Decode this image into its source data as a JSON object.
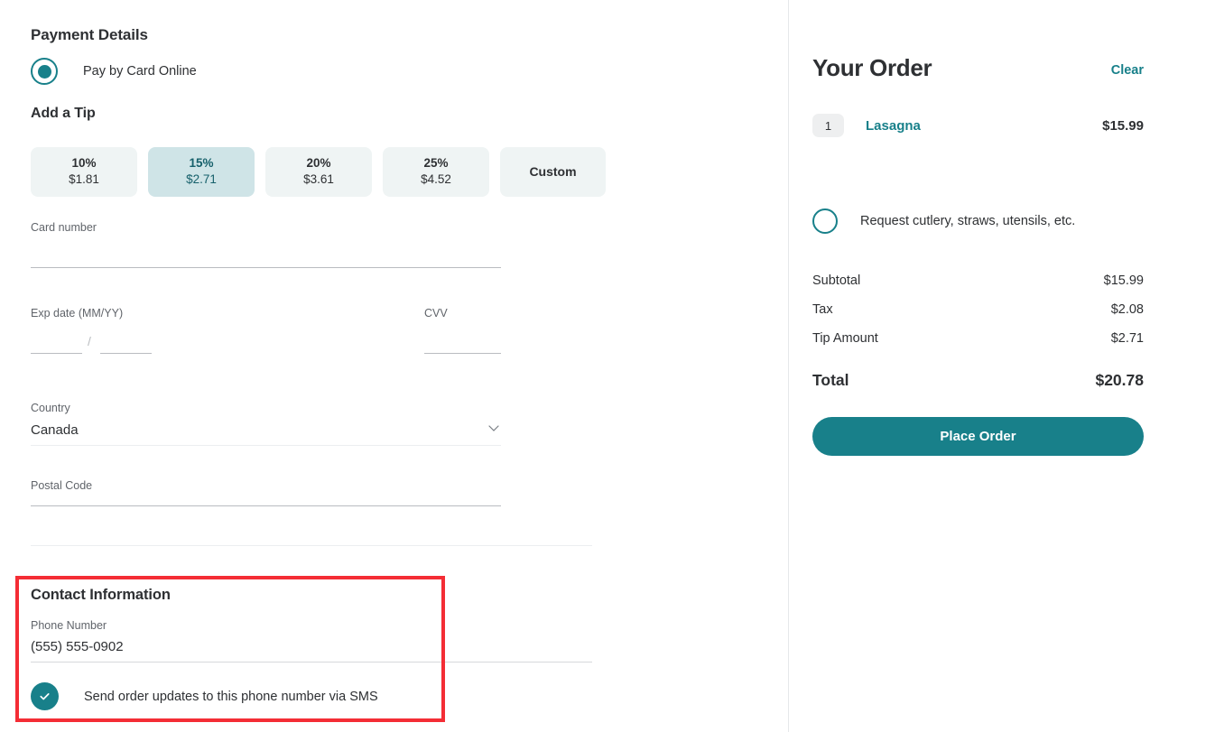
{
  "payment": {
    "section_title": "Payment Details",
    "method_label": "Pay by Card Online",
    "tip_title": "Add a Tip",
    "tips": [
      {
        "percent": "10%",
        "amount": "$1.81",
        "selected": false
      },
      {
        "percent": "15%",
        "amount": "$2.71",
        "selected": true
      },
      {
        "percent": "20%",
        "amount": "$3.61",
        "selected": false
      },
      {
        "percent": "25%",
        "amount": "$4.52",
        "selected": false
      },
      {
        "percent": "Custom",
        "amount": "",
        "selected": false
      }
    ],
    "card_number_label": "Card number",
    "card_number_value": "",
    "exp_label": "Exp date (MM/YY)",
    "exp_month_value": "",
    "exp_year_value": "",
    "exp_separator": "/",
    "cvv_label": "CVV",
    "cvv_value": "",
    "country_label": "Country",
    "country_value": "Canada",
    "postal_label": "Postal Code",
    "postal_value": ""
  },
  "contact": {
    "section_title": "Contact Information",
    "phone_label": "Phone Number",
    "phone_value": "(555) 555-0902",
    "sms_label": "Send order updates to this phone number via SMS",
    "sms_checked": true,
    "highlight_color": "#f42d35"
  },
  "order": {
    "title": "Your Order",
    "clear_label": "Clear",
    "items": [
      {
        "qty": "1",
        "name": "Lasagna",
        "price": "$15.99"
      }
    ],
    "cutlery_label": "Request cutlery, straws, utensils, etc.",
    "cutlery_checked": false,
    "totals": [
      {
        "label": "Subtotal",
        "value": "$15.99"
      },
      {
        "label": "Tax",
        "value": "$2.08"
      },
      {
        "label": "Tip Amount",
        "value": "$2.71"
      }
    ],
    "total_label": "Total",
    "total_value": "$20.78",
    "place_order_label": "Place Order"
  },
  "theme": {
    "accent": "#18808a",
    "tip_bg": "#eff4f4",
    "tip_selected_bg": "#cfe4e7",
    "tip_selected_text": "#16606b"
  }
}
